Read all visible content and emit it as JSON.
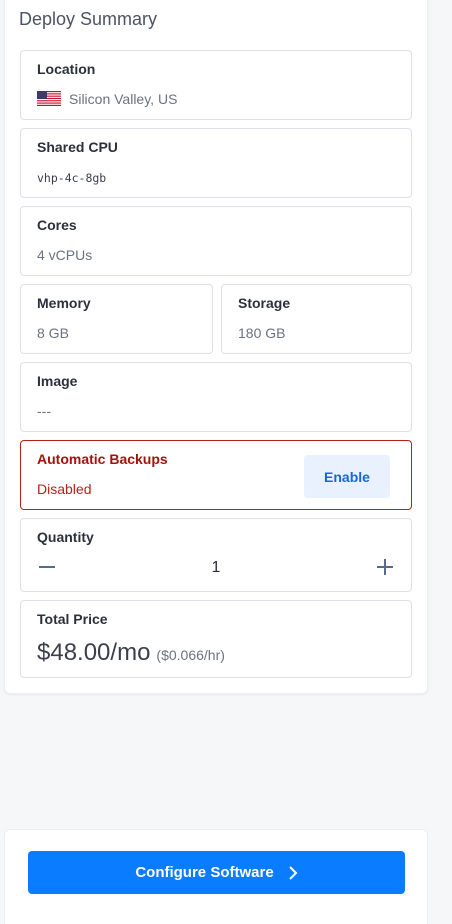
{
  "summary": {
    "title": "Deploy Summary",
    "location": {
      "label": "Location",
      "value": "Silicon Valley, US",
      "flag_icon": "us-flag-icon"
    },
    "plan": {
      "label": "Shared CPU",
      "value": "vhp-4c-8gb"
    },
    "cores": {
      "label": "Cores",
      "value": "4 vCPUs"
    },
    "memory": {
      "label": "Memory",
      "value": "8 GB"
    },
    "storage": {
      "label": "Storage",
      "value": "180 GB"
    },
    "image": {
      "label": "Image",
      "value": "---"
    },
    "backups": {
      "label": "Automatic Backups",
      "value": "Disabled",
      "button": "Enable"
    },
    "quantity": {
      "label": "Quantity",
      "value": "1",
      "minus_icon": "minus-icon",
      "plus_icon": "plus-icon"
    },
    "total": {
      "label": "Total Price",
      "monthly": "$48.00/mo",
      "hourly": "($0.066/hr)"
    }
  },
  "footer": {
    "cta_label": "Configure Software",
    "cta_icon": "chevron-right-icon"
  },
  "colors": {
    "accent": "#0a7cff",
    "danger": "#b42318",
    "enable_bg": "#e8f1fd"
  }
}
